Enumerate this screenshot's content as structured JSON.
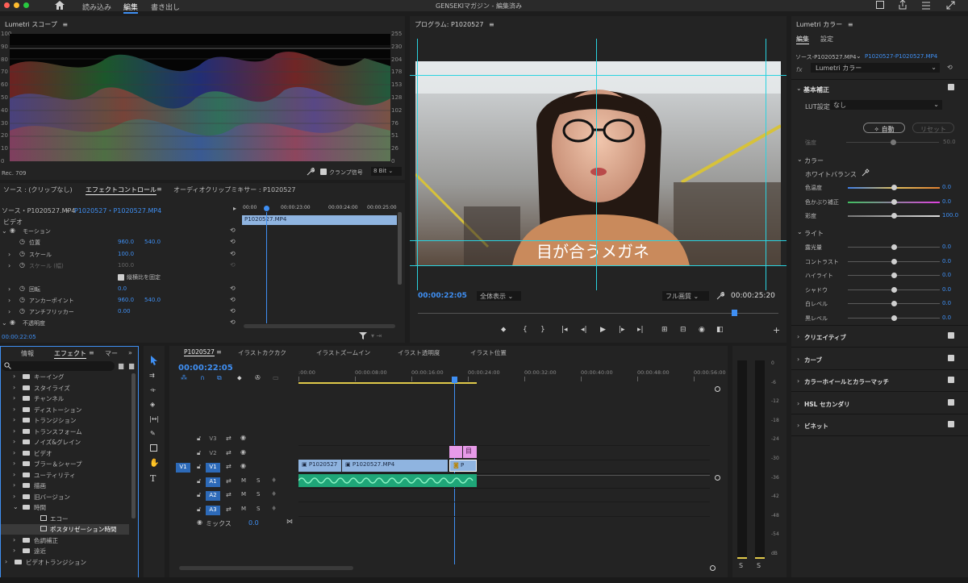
{
  "app": {
    "window_title": "GENSEKIマガジン - 編集済み",
    "workspaces": [
      "読み込み",
      "編集",
      "書き出し"
    ],
    "active_workspace": "編集"
  },
  "scope": {
    "title": "Lumetri スコープ",
    "left_ticks": [
      "100",
      "90",
      "80",
      "70",
      "60",
      "50",
      "40",
      "30",
      "20",
      "10",
      "0"
    ],
    "right_ticks": [
      "255",
      "230",
      "204",
      "178",
      "153",
      "128",
      "102",
      "76",
      "51",
      "26",
      "0"
    ],
    "colorspace": "Rec. 709",
    "clamp_label": "クランプ信号",
    "bit_depth": "8 Bit"
  },
  "effects_panel": {
    "tabs": [
      "ソース : (クリップなし)",
      "エフェクトコントロール",
      "オーディオクリップミキサー : P1020527"
    ],
    "active_tab": "エフェクトコントロール",
    "source_label": "ソース・P1020527.MP4",
    "sequence_label": "P1020527・P1020527.MP4",
    "ruler": [
      "00:00",
      "00:00:23:00",
      "00:00:24:00",
      "00:00:25:00"
    ],
    "clip_label": "P1020527.MP4",
    "section_video": "ビデオ",
    "rows": [
      {
        "label": "モーション",
        "v1": "",
        "v2": ""
      },
      {
        "label": "位置",
        "v1": "960.0",
        "v2": "540.0"
      },
      {
        "label": "スケール",
        "v1": "100.0",
        "v2": ""
      },
      {
        "label": "スケール (幅)",
        "v1": "100.0",
        "v2": ""
      },
      {
        "label": "縦横比を固定",
        "v1": "",
        "v2": ""
      },
      {
        "label": "回転",
        "v1": "0.0",
        "v2": ""
      },
      {
        "label": "アンカーポイント",
        "v1": "960.0",
        "v2": "540.0"
      },
      {
        "label": "アンチフリッカー",
        "v1": "0.00",
        "v2": ""
      },
      {
        "label": "不透明度",
        "v1": "",
        "v2": ""
      }
    ],
    "timecode": "00:00:22:05"
  },
  "program": {
    "title": "プログラム: P1020527",
    "caption": "目が合うメガネ",
    "timecode_current": "00:00:22:05",
    "zoom": "全体表示",
    "quality": "フル画質",
    "timecode_duration": "00:00:25:20"
  },
  "lumetri": {
    "title": "Lumetri カラー",
    "tabs": [
      "編集",
      "設定"
    ],
    "source_label": "ソース-P1020527.MP4",
    "sequence_label": "P1020527-P1020527.MP4",
    "fx_label": "Lumetri カラー",
    "basic": {
      "title": "基本補正",
      "lut_label": "LUT設定",
      "lut_value": "なし",
      "auto_label": "自動",
      "reset_label": "リセット",
      "intensity_label": "強度",
      "intensity_value": "50.0"
    },
    "color": {
      "title": "カラー",
      "wb_label": "ホワイトバランス",
      "sliders": [
        {
          "label": "色温度",
          "value": "0.0",
          "pos": 0.5
        },
        {
          "label": "色かぶり補正",
          "value": "0.0",
          "pos": 0.5
        },
        {
          "label": "彩度",
          "value": "100.0",
          "pos": 0.5
        }
      ]
    },
    "light": {
      "title": "ライト",
      "sliders": [
        {
          "label": "露光量",
          "value": "0.0",
          "pos": 0.5
        },
        {
          "label": "コントラスト",
          "value": "0.0",
          "pos": 0.5
        },
        {
          "label": "ハイライト",
          "value": "0.0",
          "pos": 0.5
        },
        {
          "label": "シャドウ",
          "value": "0.0",
          "pos": 0.5
        },
        {
          "label": "白レベル",
          "value": "0.0",
          "pos": 0.5
        },
        {
          "label": "黒レベル",
          "value": "0.0",
          "pos": 0.5
        }
      ]
    },
    "sections": [
      "クリエイティブ",
      "カーブ",
      "カラーホイールとカラーマッチ",
      "HSL セカンダリ",
      "ビネット"
    ]
  },
  "project": {
    "tabs": [
      "情報",
      "エフェクト",
      "マー"
    ],
    "active_tab": "エフェクト",
    "items": [
      {
        "label": "キーイング",
        "depth": 1,
        "kind": "folder"
      },
      {
        "label": "スタイライズ",
        "depth": 1,
        "kind": "folder"
      },
      {
        "label": "チャンネル",
        "depth": 1,
        "kind": "folder"
      },
      {
        "label": "ディストーション",
        "depth": 1,
        "kind": "folder"
      },
      {
        "label": "トランジション",
        "depth": 1,
        "kind": "folder"
      },
      {
        "label": "トランスフォーム",
        "depth": 1,
        "kind": "folder"
      },
      {
        "label": "ノイズ&グレイン",
        "depth": 1,
        "kind": "folder"
      },
      {
        "label": "ビデオ",
        "depth": 1,
        "kind": "folder"
      },
      {
        "label": "ブラー＆シャープ",
        "depth": 1,
        "kind": "folder"
      },
      {
        "label": "ユーティリティ",
        "depth": 1,
        "kind": "folder"
      },
      {
        "label": "描画",
        "depth": 1,
        "kind": "folder"
      },
      {
        "label": "旧バージョン",
        "depth": 1,
        "kind": "folder"
      },
      {
        "label": "時間",
        "depth": 1,
        "kind": "open"
      },
      {
        "label": "エコー",
        "depth": 2,
        "kind": "fx"
      },
      {
        "label": "ポスタリゼーション時間",
        "depth": 2,
        "kind": "fx"
      },
      {
        "label": "色調補正",
        "depth": 1,
        "kind": "folder"
      },
      {
        "label": "遠近",
        "depth": 1,
        "kind": "folder"
      },
      {
        "label": "ビデオトランジション",
        "depth": 0,
        "kind": "folder"
      }
    ]
  },
  "timeline": {
    "tabs": [
      "P1020527",
      "イラストカクカク",
      "イラストズームイン",
      "イラスト透明度",
      "イラスト位置"
    ],
    "timecode": "00:00:22:05",
    "ruler": [
      ":00:00",
      "00:00:08:00",
      "00:00:16:00",
      "00:00:24:00",
      "00:00:32:00",
      "00:00:40:00",
      "00:00:48:00",
      "00:00:56:00"
    ],
    "tracks": [
      {
        "src": "",
        "name": "V3",
        "type": "video"
      },
      {
        "src": "",
        "name": "V2",
        "type": "video"
      },
      {
        "src": "V1",
        "name": "V1",
        "type": "video"
      },
      {
        "src": "",
        "name": "A1",
        "type": "audio"
      },
      {
        "src": "",
        "name": "A2",
        "type": "audio"
      },
      {
        "src": "",
        "name": "A3",
        "type": "audio"
      }
    ],
    "mix_label": "ミックス",
    "mix_value": "0.0",
    "clips": {
      "v1_a": "P1020527",
      "v1_b": "P1020527.MP4",
      "v1_c": "P",
      "v2_a": "",
      "v2_b": "目"
    }
  },
  "audio_meter": {
    "ticks": [
      "0",
      "-6",
      "-12",
      "-18",
      "-24",
      "-30",
      "-36",
      "-42",
      "-48",
      "-54",
      "dB"
    ],
    "solo": [
      "S",
      "S"
    ]
  }
}
